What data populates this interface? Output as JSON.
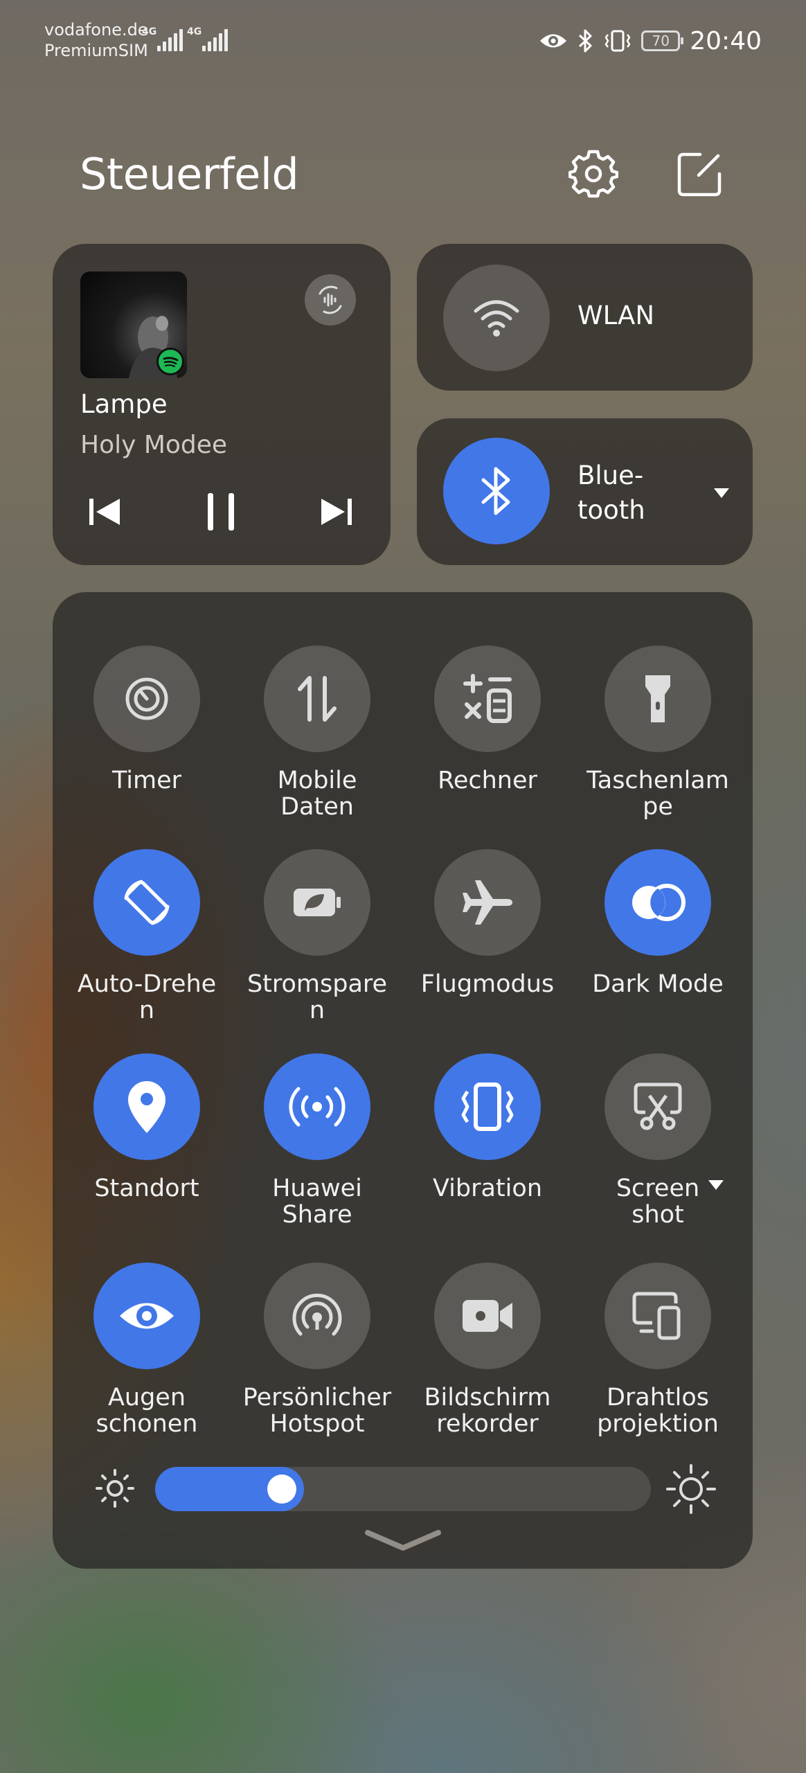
{
  "status_bar": {
    "carrier_line1": "vodafone.de",
    "carrier_line2": "PremiumSIM",
    "network_1": "4G",
    "network_2": "4G",
    "battery": "70",
    "time": "20:40"
  },
  "header": {
    "title": "Steuerfeld",
    "settings_icon": "gear-icon",
    "edit_icon": "edit-icon"
  },
  "media": {
    "song": "Lampe",
    "artist": "Holy Modee",
    "app_icon": "spotify-icon",
    "audio_output_icon": "audio-output-icon"
  },
  "quick": {
    "wlan": {
      "label": "WLAN",
      "active": false
    },
    "bluetooth": {
      "label": "Blue-\ntooth",
      "active": true
    }
  },
  "toggles": [
    {
      "label": "Timer",
      "icon": "timer-icon",
      "active": false
    },
    {
      "label": "Mobile\nDaten",
      "icon": "mobile-data-icon",
      "active": false
    },
    {
      "label": "Rechner",
      "icon": "calculator-icon",
      "active": false
    },
    {
      "label": "Taschenlam\npe",
      "icon": "flashlight-icon",
      "active": false
    },
    {
      "label": "Auto-Drehe\nn",
      "icon": "auto-rotate-icon",
      "active": true
    },
    {
      "label": "Stromspare\nn",
      "icon": "battery-saver-icon",
      "active": false
    },
    {
      "label": "Flugmodus",
      "icon": "airplane-icon",
      "active": false
    },
    {
      "label": "Dark Mode",
      "icon": "dark-mode-icon",
      "active": true
    },
    {
      "label": "Standort",
      "icon": "location-icon",
      "active": true
    },
    {
      "label": "Huawei\nShare",
      "icon": "huawei-share-icon",
      "active": true
    },
    {
      "label": "Vibration",
      "icon": "vibration-icon",
      "active": true
    },
    {
      "label": "Screen\nshot",
      "icon": "screenshot-icon",
      "active": false
    },
    {
      "label": "Augen\nschonen",
      "icon": "eye-comfort-icon",
      "active": true
    },
    {
      "label": "Persönlicher\nHotspot",
      "icon": "hotspot-icon",
      "active": false
    },
    {
      "label": "Bildschirm\nrekorder",
      "icon": "screen-recorder-icon",
      "active": false
    },
    {
      "label": "Drahtlos\nprojektion",
      "icon": "wireless-projection-icon",
      "active": false
    }
  ],
  "brightness": {
    "level": 0.3
  },
  "colors": {
    "accent": "#4277e8"
  }
}
